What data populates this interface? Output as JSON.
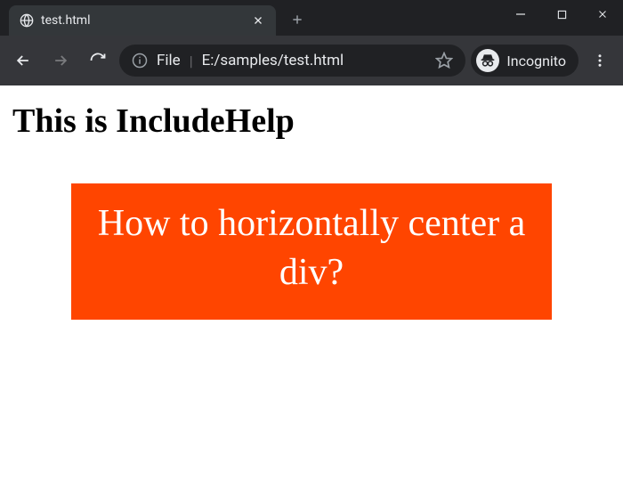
{
  "window": {
    "tab_title": "test.html",
    "incognito_label": "Incognito"
  },
  "addressbar": {
    "scheme": "File",
    "path": "E:/samples/test.html"
  },
  "page": {
    "heading": "This is IncludeHelp",
    "box_text": "How to horizontally center a div?"
  },
  "colors": {
    "box_bg": "#ff4500"
  }
}
